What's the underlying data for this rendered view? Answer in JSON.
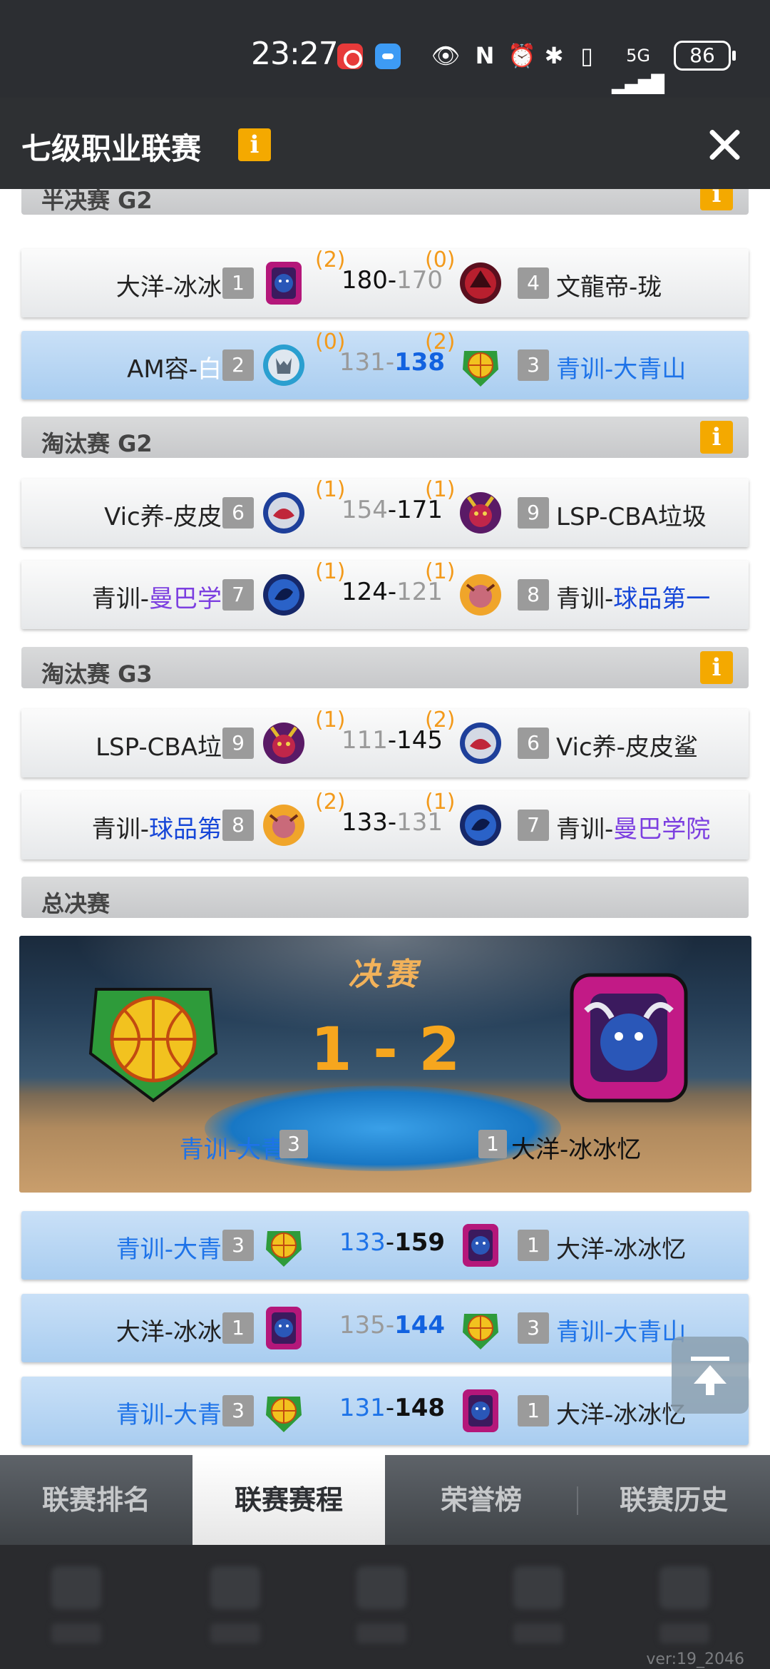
{
  "status_bar": {
    "time": "23:27",
    "battery": "86",
    "network": "5G"
  },
  "header": {
    "title": "七级职业联赛",
    "info_icon": "i"
  },
  "sections": [
    {
      "title": "半决赛 G2",
      "info": "i"
    },
    {
      "title": "淘汰赛 G2",
      "info": "i"
    },
    {
      "title": "淘汰赛 G3",
      "info": "i"
    },
    {
      "title": "总决赛"
    }
  ],
  "matches": [
    {
      "home_a": "大洋-",
      "home_b": "冰冰忆",
      "home_seed": "1",
      "home_wins": "(2)",
      "home_score": "180",
      "sep": "-",
      "away_score": "170",
      "away_wins": "(0)",
      "away_seed": "4",
      "away_a": "文龍帝-",
      "away_b": "珑"
    },
    {
      "home_a": "AM容-",
      "home_b": "白狼",
      "home_seed": "2",
      "home_wins": "(0)",
      "home_score": "131",
      "sep": "-",
      "away_score": "138",
      "away_wins": "(2)",
      "away_seed": "3",
      "away_a": "青训-",
      "away_b": "大青山"
    },
    {
      "home_a": "Vic养-",
      "home_b": "皮皮鲨",
      "home_seed": "6",
      "home_wins": "(1)",
      "home_score": "154",
      "sep": "-",
      "away_score": "171",
      "away_wins": "(1)",
      "away_seed": "9",
      "away_a": "LSP-",
      "away_b": "CBA垃圾"
    },
    {
      "home_a": "青训-",
      "home_b": "曼巴学院",
      "home_seed": "7",
      "home_wins": "(1)",
      "home_score": "124",
      "sep": "-",
      "away_score": "121",
      "away_wins": "(1)",
      "away_seed": "8",
      "away_a": "青训-",
      "away_b": "球品第一"
    },
    {
      "home_a": "LSP-",
      "home_b": "CBA垃圾",
      "home_seed": "9",
      "home_wins": "(1)",
      "home_score": "111",
      "sep": "-",
      "away_score": "145",
      "away_wins": "(2)",
      "away_seed": "6",
      "away_a": "Vic养-",
      "away_b": "皮皮鲨"
    },
    {
      "home_a": "青训-",
      "home_b": "球品第一",
      "home_seed": "8",
      "home_wins": "(2)",
      "home_score": "133",
      "sep": "-",
      "away_score": "131",
      "away_wins": "(1)",
      "away_seed": "7",
      "away_a": "青训-",
      "away_b": "曼巴学院"
    },
    {
      "home_a": "青训-",
      "home_b": "大青山",
      "home_seed": "3",
      "home_score": "133",
      "sep": "-",
      "away_score": "159",
      "away_seed": "1",
      "away_a": "大洋-",
      "away_b": "冰冰忆"
    },
    {
      "home_a": "大洋-",
      "home_b": "冰冰忆",
      "home_seed": "1",
      "home_score": "135",
      "sep": "-",
      "away_score": "144",
      "away_seed": "3",
      "away_a": "青训-",
      "away_b": "大青山"
    },
    {
      "home_a": "青训-",
      "home_b": "大青山",
      "home_seed": "3",
      "home_score": "131",
      "sep": "-",
      "away_score": "148",
      "away_seed": "1",
      "away_a": "大洋-",
      "away_b": "冰冰忆"
    }
  ],
  "finals": {
    "title": "决赛",
    "score": "1 - 2",
    "home_name": "青训-大青山",
    "home_seed": "3",
    "away_name": "大洋-冰冰忆",
    "away_seed": "1"
  },
  "tabs": [
    "联赛排名",
    "联赛赛程",
    "荣誉榜",
    "联赛历史"
  ],
  "active_tab": "联赛赛程",
  "version": "ver:19_2046",
  "colors": {
    "accent": "#f4a900",
    "highlight_row": "#b8d6f4",
    "win_blue": "#1262e0",
    "wins_orange": "#f39a1b"
  }
}
